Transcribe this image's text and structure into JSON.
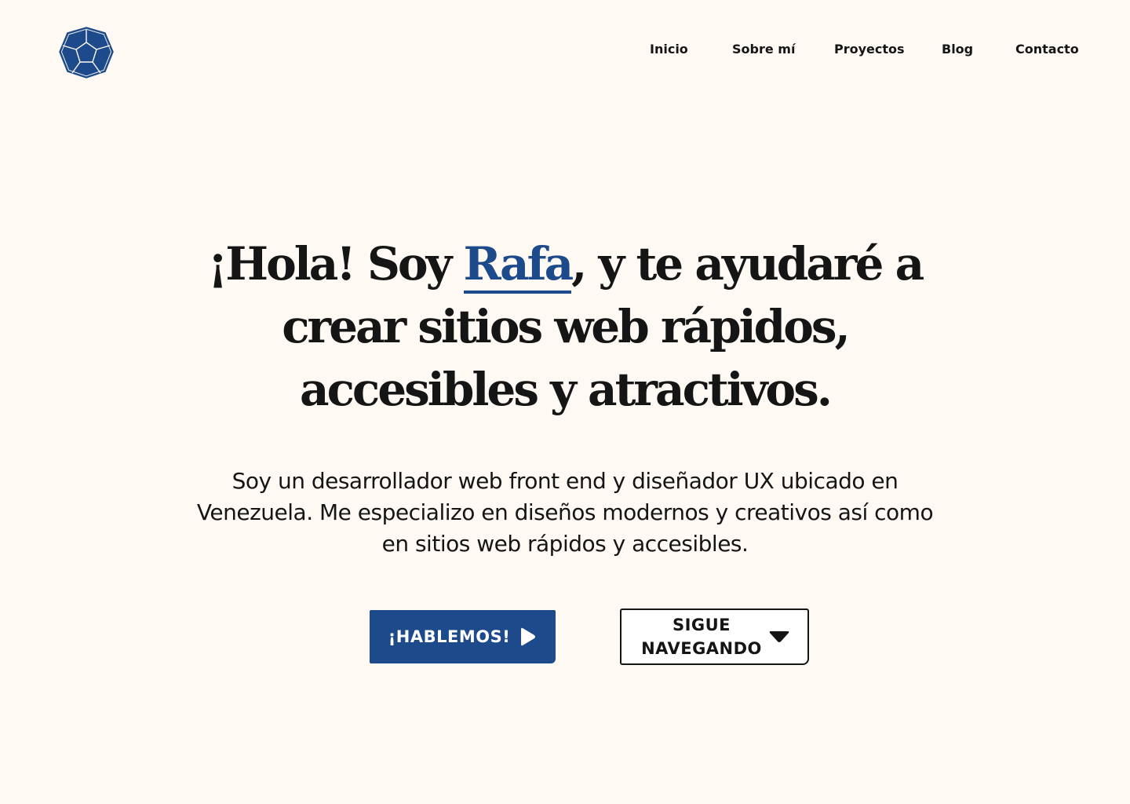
{
  "header": {
    "logo_icon": "dodecahedron-logo-icon",
    "nav": [
      {
        "label": "Inicio"
      },
      {
        "label": "Sobre mí"
      },
      {
        "label": "Proyectos"
      },
      {
        "label": "Blog"
      },
      {
        "label": "Contacto"
      }
    ]
  },
  "hero": {
    "title_before": "¡Hola! Soy ",
    "title_name": "Rafa",
    "title_after": ", y te ayudaré a crear sitios web rápidos, accesibles y atractivos.",
    "description": "Soy un desarrollador web front end y diseñador UX ubicado en Venezuela. Me especializo en diseños modernos y creativos así como en sitios web rápidos y accesibles.",
    "primary_button": {
      "label": "¡HABLEMOS!",
      "icon": "play-icon"
    },
    "secondary_button": {
      "label": "SIGUE NAVEGANDO",
      "icon": "caret-down-icon"
    }
  },
  "colors": {
    "background": "#fef9f3",
    "accent": "#1d4a8a",
    "text": "#151515"
  }
}
